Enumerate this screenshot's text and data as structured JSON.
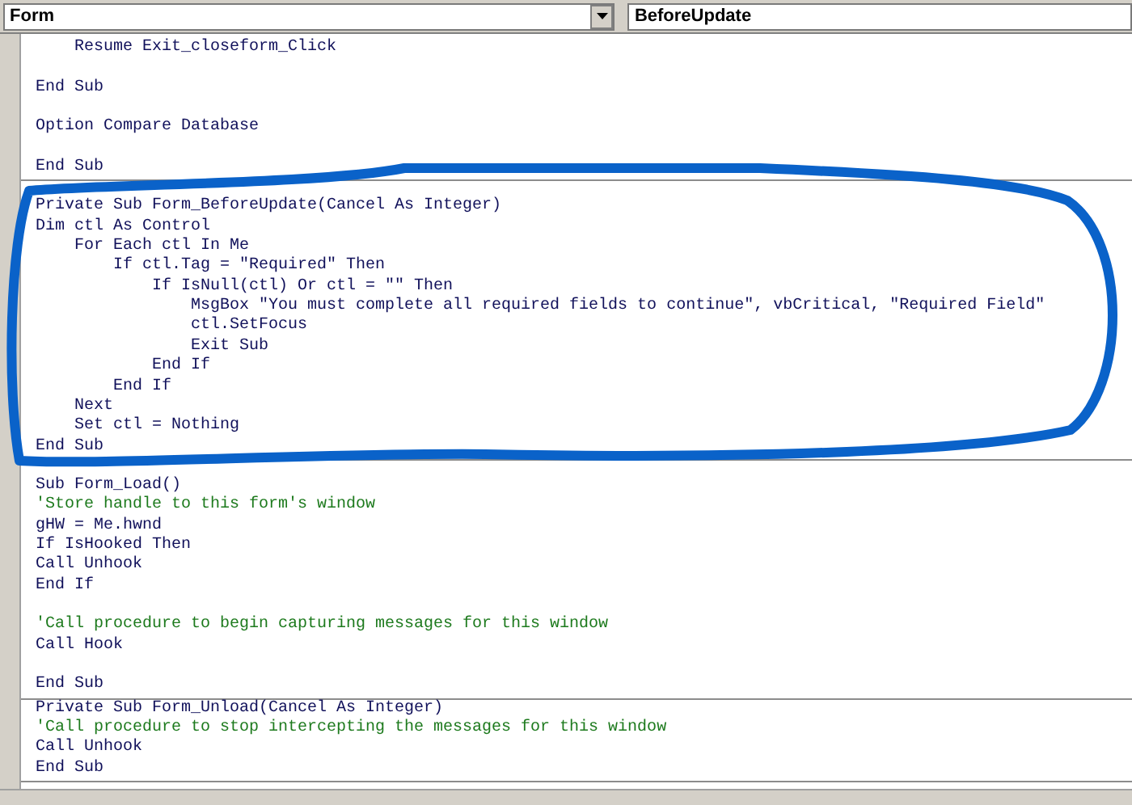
{
  "toolbar": {
    "object": "Form",
    "procedure": "BeforeUpdate"
  },
  "sections": [
    {
      "lines": [
        {
          "kind": "code",
          "text": "    Resume Exit_closeform_Click"
        },
        {
          "kind": "blank"
        },
        {
          "kind": "code",
          "text": "End Sub"
        },
        {
          "kind": "blank"
        },
        {
          "kind": "code",
          "text": "Option Compare Database"
        },
        {
          "kind": "blank"
        },
        {
          "kind": "code",
          "text": "End Sub"
        }
      ]
    },
    {
      "lines": [
        {
          "kind": "code",
          "text": "Private Sub Form_BeforeUpdate(Cancel As Integer)"
        },
        {
          "kind": "code",
          "text": "Dim ctl As Control"
        },
        {
          "kind": "code",
          "text": "    For Each ctl In Me"
        },
        {
          "kind": "code",
          "text": "        If ctl.Tag = \"Required\" Then"
        },
        {
          "kind": "code",
          "text": "            If IsNull(ctl) Or ctl = \"\" Then"
        },
        {
          "kind": "code",
          "text": "                MsgBox \"You must complete all required fields to continue\", vbCritical, \"Required Field\""
        },
        {
          "kind": "code",
          "text": "                ctl.SetFocus"
        },
        {
          "kind": "code",
          "text": "                Exit Sub"
        },
        {
          "kind": "code",
          "text": "            End If"
        },
        {
          "kind": "code",
          "text": "        End If"
        },
        {
          "kind": "code",
          "text": "    Next"
        },
        {
          "kind": "code",
          "text": "    Set ctl = Nothing"
        },
        {
          "kind": "code",
          "text": "End Sub"
        }
      ]
    },
    {
      "lines": [
        {
          "kind": "code",
          "text": "Sub Form_Load()"
        },
        {
          "kind": "comment",
          "text": "'Store handle to this form's window"
        },
        {
          "kind": "code",
          "text": "gHW = Me.hwnd"
        },
        {
          "kind": "code",
          "text": "If IsHooked Then"
        },
        {
          "kind": "code",
          "text": "Call Unhook"
        },
        {
          "kind": "code",
          "text": "End If"
        },
        {
          "kind": "blank"
        },
        {
          "kind": "comment",
          "text": "'Call procedure to begin capturing messages for this window"
        },
        {
          "kind": "code",
          "text": "Call Hook"
        },
        {
          "kind": "blank"
        },
        {
          "kind": "code",
          "text": "End Sub"
        }
      ]
    },
    {
      "lines": [
        {
          "kind": "code",
          "text": "Private Sub Form_Unload(Cancel As Integer)"
        },
        {
          "kind": "comment",
          "text": "'Call procedure to stop intercepting the messages for this window"
        },
        {
          "kind": "code",
          "text": "Call Unhook"
        },
        {
          "kind": "code",
          "text": "End Sub"
        }
      ]
    }
  ],
  "annotation": {
    "kind": "ellipse"
  }
}
